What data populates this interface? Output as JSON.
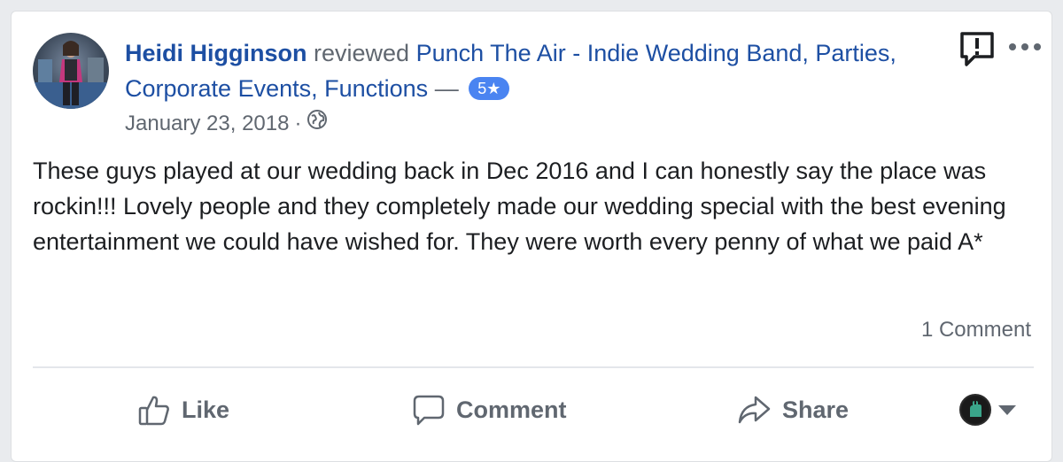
{
  "review": {
    "reviewer_name": "Heidi Higginson",
    "action_text": "reviewed",
    "page_name": "Punch The Air - Indie Wedding Band, Parties, Corporate Events, Functions",
    "separator": "—",
    "rating": "5",
    "rating_star": "★",
    "date": "January 23, 2018",
    "meta_separator": "·",
    "privacy_icon": "globe-icon",
    "text": "These guys played at our wedding back in Dec 2016 and I can honestly say the place was rockin!!! Lovely people and they completely made our wedding special with the best evening entertainment we could have wished for. They were worth every penny of what we paid A*",
    "comment_count": "1 Comment"
  },
  "actions": {
    "like_label": "Like",
    "comment_label": "Comment",
    "share_label": "Share"
  },
  "icons": {
    "report": "report-feedback-icon",
    "more": "more-options-icon",
    "like": "thumbs-up-icon",
    "comment": "speech-bubble-icon",
    "share": "share-arrow-icon",
    "audience": "page-avatar-icon"
  },
  "colors": {
    "link": "#1d4fa3",
    "badge": "#4a84f1",
    "muted": "#606770",
    "text": "#1c1e21"
  }
}
